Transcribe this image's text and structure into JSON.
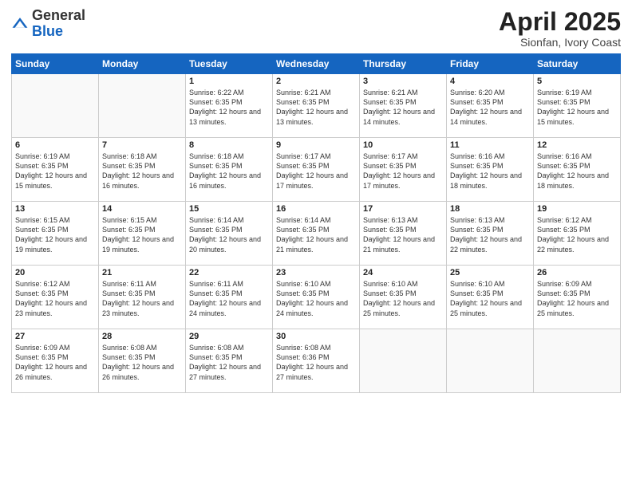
{
  "header": {
    "logo_general": "General",
    "logo_blue": "Blue",
    "month_title": "April 2025",
    "subtitle": "Sionfan, Ivory Coast"
  },
  "weekdays": [
    "Sunday",
    "Monday",
    "Tuesday",
    "Wednesday",
    "Thursday",
    "Friday",
    "Saturday"
  ],
  "weeks": [
    [
      {
        "day": "",
        "sunrise": "",
        "sunset": "",
        "daylight": ""
      },
      {
        "day": "",
        "sunrise": "",
        "sunset": "",
        "daylight": ""
      },
      {
        "day": "1",
        "sunrise": "Sunrise: 6:22 AM",
        "sunset": "Sunset: 6:35 PM",
        "daylight": "Daylight: 12 hours and 13 minutes."
      },
      {
        "day": "2",
        "sunrise": "Sunrise: 6:21 AM",
        "sunset": "Sunset: 6:35 PM",
        "daylight": "Daylight: 12 hours and 13 minutes."
      },
      {
        "day": "3",
        "sunrise": "Sunrise: 6:21 AM",
        "sunset": "Sunset: 6:35 PM",
        "daylight": "Daylight: 12 hours and 14 minutes."
      },
      {
        "day": "4",
        "sunrise": "Sunrise: 6:20 AM",
        "sunset": "Sunset: 6:35 PM",
        "daylight": "Daylight: 12 hours and 14 minutes."
      },
      {
        "day": "5",
        "sunrise": "Sunrise: 6:19 AM",
        "sunset": "Sunset: 6:35 PM",
        "daylight": "Daylight: 12 hours and 15 minutes."
      }
    ],
    [
      {
        "day": "6",
        "sunrise": "Sunrise: 6:19 AM",
        "sunset": "Sunset: 6:35 PM",
        "daylight": "Daylight: 12 hours and 15 minutes."
      },
      {
        "day": "7",
        "sunrise": "Sunrise: 6:18 AM",
        "sunset": "Sunset: 6:35 PM",
        "daylight": "Daylight: 12 hours and 16 minutes."
      },
      {
        "day": "8",
        "sunrise": "Sunrise: 6:18 AM",
        "sunset": "Sunset: 6:35 PM",
        "daylight": "Daylight: 12 hours and 16 minutes."
      },
      {
        "day": "9",
        "sunrise": "Sunrise: 6:17 AM",
        "sunset": "Sunset: 6:35 PM",
        "daylight": "Daylight: 12 hours and 17 minutes."
      },
      {
        "day": "10",
        "sunrise": "Sunrise: 6:17 AM",
        "sunset": "Sunset: 6:35 PM",
        "daylight": "Daylight: 12 hours and 17 minutes."
      },
      {
        "day": "11",
        "sunrise": "Sunrise: 6:16 AM",
        "sunset": "Sunset: 6:35 PM",
        "daylight": "Daylight: 12 hours and 18 minutes."
      },
      {
        "day": "12",
        "sunrise": "Sunrise: 6:16 AM",
        "sunset": "Sunset: 6:35 PM",
        "daylight": "Daylight: 12 hours and 18 minutes."
      }
    ],
    [
      {
        "day": "13",
        "sunrise": "Sunrise: 6:15 AM",
        "sunset": "Sunset: 6:35 PM",
        "daylight": "Daylight: 12 hours and 19 minutes."
      },
      {
        "day": "14",
        "sunrise": "Sunrise: 6:15 AM",
        "sunset": "Sunset: 6:35 PM",
        "daylight": "Daylight: 12 hours and 19 minutes."
      },
      {
        "day": "15",
        "sunrise": "Sunrise: 6:14 AM",
        "sunset": "Sunset: 6:35 PM",
        "daylight": "Daylight: 12 hours and 20 minutes."
      },
      {
        "day": "16",
        "sunrise": "Sunrise: 6:14 AM",
        "sunset": "Sunset: 6:35 PM",
        "daylight": "Daylight: 12 hours and 21 minutes."
      },
      {
        "day": "17",
        "sunrise": "Sunrise: 6:13 AM",
        "sunset": "Sunset: 6:35 PM",
        "daylight": "Daylight: 12 hours and 21 minutes."
      },
      {
        "day": "18",
        "sunrise": "Sunrise: 6:13 AM",
        "sunset": "Sunset: 6:35 PM",
        "daylight": "Daylight: 12 hours and 22 minutes."
      },
      {
        "day": "19",
        "sunrise": "Sunrise: 6:12 AM",
        "sunset": "Sunset: 6:35 PM",
        "daylight": "Daylight: 12 hours and 22 minutes."
      }
    ],
    [
      {
        "day": "20",
        "sunrise": "Sunrise: 6:12 AM",
        "sunset": "Sunset: 6:35 PM",
        "daylight": "Daylight: 12 hours and 23 minutes."
      },
      {
        "day": "21",
        "sunrise": "Sunrise: 6:11 AM",
        "sunset": "Sunset: 6:35 PM",
        "daylight": "Daylight: 12 hours and 23 minutes."
      },
      {
        "day": "22",
        "sunrise": "Sunrise: 6:11 AM",
        "sunset": "Sunset: 6:35 PM",
        "daylight": "Daylight: 12 hours and 24 minutes."
      },
      {
        "day": "23",
        "sunrise": "Sunrise: 6:10 AM",
        "sunset": "Sunset: 6:35 PM",
        "daylight": "Daylight: 12 hours and 24 minutes."
      },
      {
        "day": "24",
        "sunrise": "Sunrise: 6:10 AM",
        "sunset": "Sunset: 6:35 PM",
        "daylight": "Daylight: 12 hours and 25 minutes."
      },
      {
        "day": "25",
        "sunrise": "Sunrise: 6:10 AM",
        "sunset": "Sunset: 6:35 PM",
        "daylight": "Daylight: 12 hours and 25 minutes."
      },
      {
        "day": "26",
        "sunrise": "Sunrise: 6:09 AM",
        "sunset": "Sunset: 6:35 PM",
        "daylight": "Daylight: 12 hours and 25 minutes."
      }
    ],
    [
      {
        "day": "27",
        "sunrise": "Sunrise: 6:09 AM",
        "sunset": "Sunset: 6:35 PM",
        "daylight": "Daylight: 12 hours and 26 minutes."
      },
      {
        "day": "28",
        "sunrise": "Sunrise: 6:08 AM",
        "sunset": "Sunset: 6:35 PM",
        "daylight": "Daylight: 12 hours and 26 minutes."
      },
      {
        "day": "29",
        "sunrise": "Sunrise: 6:08 AM",
        "sunset": "Sunset: 6:35 PM",
        "daylight": "Daylight: 12 hours and 27 minutes."
      },
      {
        "day": "30",
        "sunrise": "Sunrise: 6:08 AM",
        "sunset": "Sunset: 6:36 PM",
        "daylight": "Daylight: 12 hours and 27 minutes."
      },
      {
        "day": "",
        "sunrise": "",
        "sunset": "",
        "daylight": ""
      },
      {
        "day": "",
        "sunrise": "",
        "sunset": "",
        "daylight": ""
      },
      {
        "day": "",
        "sunrise": "",
        "sunset": "",
        "daylight": ""
      }
    ]
  ]
}
